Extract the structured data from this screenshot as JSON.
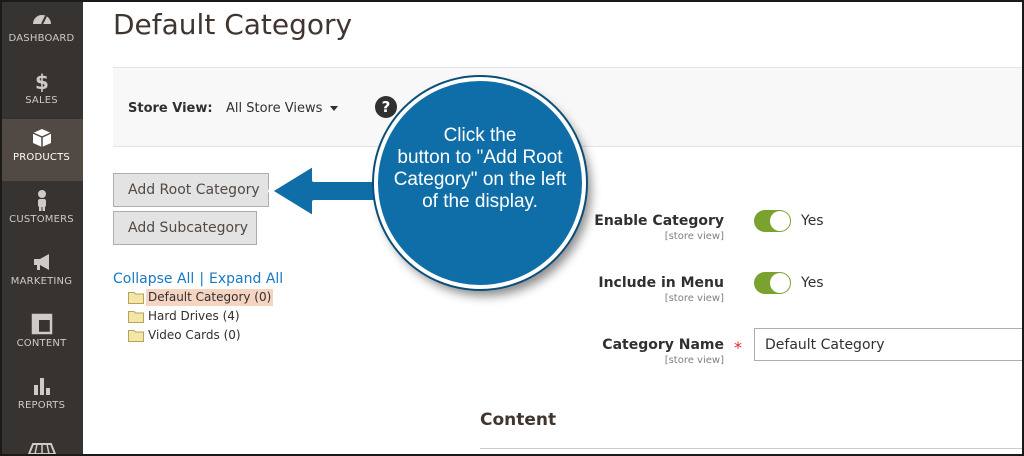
{
  "sidebar": {
    "items": [
      {
        "label": "DASHBOARD",
        "icon": "dashboard-icon"
      },
      {
        "label": "SALES",
        "icon": "dollar-icon"
      },
      {
        "label": "PRODUCTS",
        "icon": "box-icon",
        "active": true
      },
      {
        "label": "CUSTOMERS",
        "icon": "person-icon"
      },
      {
        "label": "MARKETING",
        "icon": "megaphone-icon"
      },
      {
        "label": "CONTENT",
        "icon": "layout-icon"
      },
      {
        "label": "REPORTS",
        "icon": "bar-chart-icon"
      }
    ]
  },
  "page": {
    "title": "Default Category"
  },
  "store_view": {
    "label": "Store View:",
    "value": "All Store Views",
    "help": "?"
  },
  "actions": {
    "add_root": "Add Root Category",
    "add_sub": "Add Subcategory"
  },
  "tree": {
    "collapse": "Collapse All",
    "separator": "|",
    "expand": "Expand All",
    "items": [
      {
        "label": "Default Category (0)",
        "selected": true
      },
      {
        "label": "Hard Drives (4)"
      },
      {
        "label": "Video Cards (0)"
      }
    ]
  },
  "form": {
    "enable": {
      "label": "Enable Category",
      "scope": "[store view]",
      "value": "Yes"
    },
    "menu": {
      "label": "Include in Menu",
      "scope": "[store view]",
      "value": "Yes"
    },
    "name": {
      "label": "Category Name",
      "scope": "[store view]",
      "required": "*",
      "value": "Default Category"
    },
    "content_heading": "Content"
  },
  "callout": {
    "line1": "Click the",
    "line2": "button to \"Add Root",
    "line3": "Category\" on the left",
    "line4": "of the display."
  },
  "colors": {
    "sidebar": "#373330",
    "accent": "#0f6ea8",
    "toggle_on": "#79a22e",
    "link": "#1979c3"
  }
}
